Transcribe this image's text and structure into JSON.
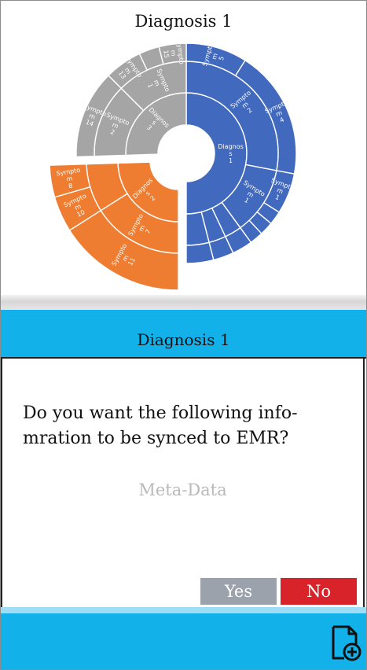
{
  "chart": {
    "title": "Diagnosis 1"
  },
  "chart_data": {
    "type": "sunburst",
    "title": "Diagnosis 1",
    "colors": {
      "Diagnosis 1": "#4169be",
      "Diagnosis 2": "#ee7d31",
      "Diagnosis 3": "#a5a5a5"
    },
    "hierarchy": [
      {
        "name": "Diagnos s 1",
        "color": "#4169be",
        "value": 50,
        "children": [
          {
            "name": "Sympto m 2",
            "value": 28,
            "children": [
              {
                "name": "Sympto m 5",
                "value": 9
              },
              {
                "name": "Sympto m 4",
                "value": 19
              }
            ]
          },
          {
            "name": "Sympto m 1",
            "value": 12,
            "children": [
              {
                "name": "Sympto m 1",
                "value": 6
              },
              {
                "name": "",
                "value": 2
              },
              {
                "name": "",
                "value": 2
              },
              {
                "name": "",
                "value": 2
              }
            ]
          },
          {
            "name": "",
            "value": 3,
            "children": [
              {
                "name": "",
                "value": 3
              }
            ]
          },
          {
            "name": "",
            "value": 3,
            "children": [
              {
                "name": "",
                "value": 3
              }
            ]
          },
          {
            "name": "",
            "value": 4,
            "children": [
              {
                "name": "",
                "value": 4
              }
            ]
          }
        ]
      },
      {
        "name": "Diagnos s 2",
        "color": "#ee7d31",
        "value": 24.5,
        "children": [
          {
            "name": "Sympto m 7",
            "value": 16,
            "children": [
              {
                "name": "Sympto m 11",
                "value": 16
              }
            ]
          },
          {
            "name": "",
            "value": 8.5,
            "children": [
              {
                "name": "Sympto m 10",
                "value": 4.5
              },
              {
                "name": "Sympto m 8",
                "value": 4
              }
            ]
          }
        ]
      },
      {
        "name": "Diagnos s 3",
        "color": "#a5a5a5",
        "value": 25.5,
        "children": [
          {
            "name": "Sympto m 2",
            "value": 13,
            "children": [
              {
                "name": "Sympto m 14",
                "value": 13
              }
            ]
          },
          {
            "name": "Sympto m 1",
            "value": 12.5,
            "children": [
              {
                "name": "Sympto m 13",
                "value": 5.5
              },
              {
                "name": "",
                "value": 3
              },
              {
                "name": "Sympto m 15",
                "value": 4
              }
            ]
          }
        ]
      }
    ]
  },
  "dialog": {
    "title": "Diagnosis 1",
    "question": "Do you want the following info-mration to be synced to EMR?",
    "meta": "Meta-Data",
    "yes_label": "Yes",
    "no_label": "No"
  },
  "footer": {
    "icon": "add-document-icon"
  }
}
